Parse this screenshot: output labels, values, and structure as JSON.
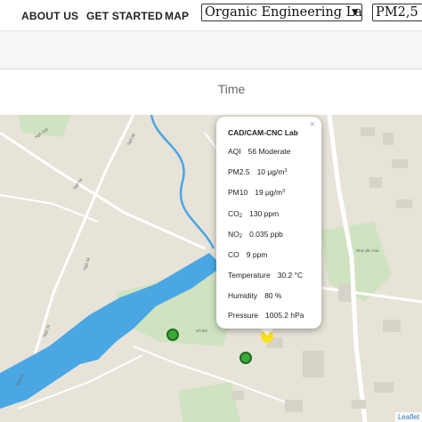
{
  "nav": {
    "about_label": "ABOUT US",
    "get_started_label": "GET STARTED",
    "map_label": "MAP",
    "site_select_value": "Organic Engineering Lab",
    "site_select_arrow": "▼",
    "param_select_value": "PM2,5"
  },
  "time_label": "Time",
  "popup": {
    "close": "×",
    "title": "CAD/CAM-CNC Lab",
    "aqi_label": "AQI",
    "aqi_value": "56 Moderate",
    "pm25_label": "PM2.5",
    "pm25_value": "10 μg/m",
    "pm25_unit_sup": "3",
    "pm10_label": "PM10",
    "pm10_value": "19 μg/m",
    "pm10_unit_sup": "3",
    "co2_label_main": "CO",
    "co2_label_sub": "2",
    "co2_value": "130 ppm",
    "no2_label_main": "NO",
    "no2_label_sub": "2",
    "no2_value": "0.035 ppb",
    "co_label": "CO",
    "co_value": "9 ppm",
    "temp_label": "Temperature",
    "temp_value": "30.2 °C",
    "humidity_label": "Humidity",
    "humidity_value": "80 %",
    "pressure_label": "Pressure",
    "pressure_value": "1005.2 hPa"
  },
  "map": {
    "attribution": "Leaflet",
    "labels": [
      "Ngõ 100",
      "Ngõ 99",
      "Ngõ 44",
      "Ngõ 32",
      "Ngõ 48",
      "Ngõ 43",
      "Hồ Đá",
      "Nhà văn hóa"
    ],
    "colors": {
      "water": "#4aa7e4",
      "park": "#cfe3c0",
      "road": "#ffffff",
      "building": "#d8d3c9",
      "marker_green": "#3aa83a",
      "marker_yellow": "#f7e21c"
    }
  }
}
